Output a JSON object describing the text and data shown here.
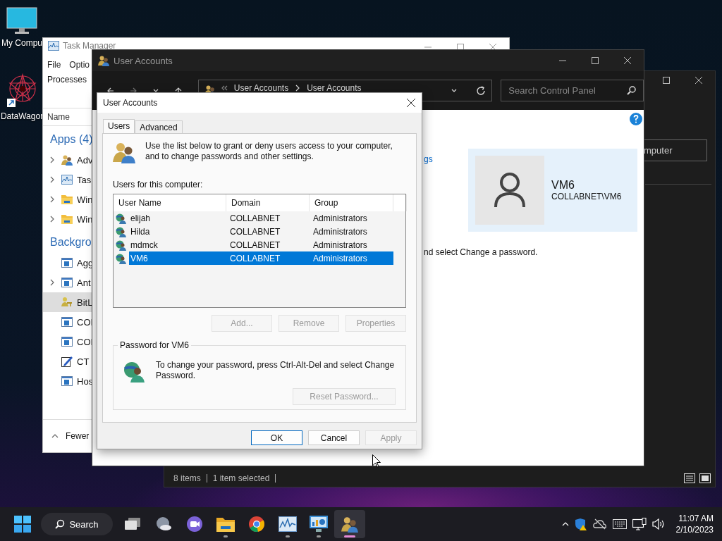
{
  "desktop": {
    "icons": [
      {
        "label": "My Compu",
        "kind": "monitor"
      },
      {
        "label": "DataWagor",
        "kind": "mandala"
      }
    ]
  },
  "task_manager": {
    "title": "Task Manager",
    "menu": [
      "File",
      "Optio"
    ],
    "tab": "Processes",
    "column": "Name",
    "groups": [
      {
        "title": "Apps (4)",
        "rows": [
          {
            "label": "Adv",
            "kind": "users",
            "expandable": true,
            "selected": false
          },
          {
            "label": "Tas",
            "kind": "chart",
            "expandable": true,
            "selected": false
          },
          {
            "label": "Win",
            "kind": "folder",
            "expandable": true,
            "selected": false
          },
          {
            "label": "Win",
            "kind": "folder",
            "expandable": true,
            "selected": false
          }
        ]
      },
      {
        "title": "Backgro",
        "rows": [
          {
            "label": "Agg",
            "kind": "service",
            "expandable": false,
            "selected": false
          },
          {
            "label": "Ant",
            "kind": "service",
            "expandable": true,
            "selected": false
          },
          {
            "label": "BitL",
            "kind": "keyusers",
            "expandable": false,
            "selected": true
          },
          {
            "label": "COI",
            "kind": "service",
            "expandable": false,
            "selected": false
          },
          {
            "label": "COI",
            "kind": "service",
            "expandable": false,
            "selected": false
          },
          {
            "label": "CT",
            "kind": "pen",
            "expandable": false,
            "selected": false
          },
          {
            "label": "Hos",
            "kind": "service",
            "expandable": false,
            "selected": false
          }
        ]
      }
    ],
    "footer": "Fewer"
  },
  "explorer_back": {
    "button": "mputer",
    "status": [
      "8 items",
      "1 item selected"
    ]
  },
  "control_panel": {
    "title": "User Accounts",
    "breadcrumb": [
      "User Accounts",
      "User Accounts"
    ],
    "search": {
      "placeholder": "Search Control Panel"
    },
    "link_fragment": "gs",
    "user": {
      "name": "VM6",
      "account": "COLLABNET\\VM6"
    },
    "text_fragment": "nd select Change a password."
  },
  "dialog": {
    "title": "User Accounts",
    "tabs": [
      {
        "label": "Users",
        "selected": true
      },
      {
        "label": "Advanced",
        "selected": false
      }
    ],
    "intro": "Use the list below to grant or deny users access to your computer, and to change passwords and other settings.",
    "list_label": "Users for this computer:",
    "columns": [
      "User Name",
      "Domain",
      "Group"
    ],
    "rows": [
      {
        "user": "elijah",
        "domain": "COLLABNET",
        "group": "Administrators",
        "selected": false
      },
      {
        "user": "Hilda",
        "domain": "COLLABNET",
        "group": "Administrators",
        "selected": false
      },
      {
        "user": "mdmck",
        "domain": "COLLABNET",
        "group": "Administrators",
        "selected": false
      },
      {
        "user": "VM6",
        "domain": "COLLABNET",
        "group": "Administrators",
        "selected": true
      }
    ],
    "list_buttons": [
      {
        "label": "Add...",
        "disabled": true
      },
      {
        "label": "Remove",
        "disabled": true
      },
      {
        "label": "Properties",
        "disabled": true
      }
    ],
    "password": {
      "title": "Password for VM6",
      "text": "To change your password, press Ctrl-Alt-Del and select Change Password.",
      "button": {
        "label": "Reset Password...",
        "disabled": true
      }
    },
    "buttons": [
      {
        "label": "OK",
        "default": true,
        "disabled": false
      },
      {
        "label": "Cancel",
        "default": false,
        "disabled": false
      },
      {
        "label": "Apply",
        "default": false,
        "disabled": true
      }
    ]
  },
  "taskbar": {
    "search": "Search",
    "apps": [
      {
        "kind": "taskview",
        "running": false,
        "selected": false
      },
      {
        "kind": "weather",
        "running": false,
        "selected": false
      },
      {
        "kind": "chat",
        "running": false,
        "selected": false
      },
      {
        "kind": "folder",
        "running": true,
        "selected": false
      },
      {
        "kind": "browser",
        "running": false,
        "selected": false
      },
      {
        "kind": "chart",
        "running": true,
        "selected": false
      },
      {
        "kind": "screen",
        "running": true,
        "selected": false
      },
      {
        "kind": "users",
        "running": true,
        "selected": true
      }
    ],
    "clock": {
      "time": "11:07 AM",
      "date": "2/10/2023"
    }
  }
}
